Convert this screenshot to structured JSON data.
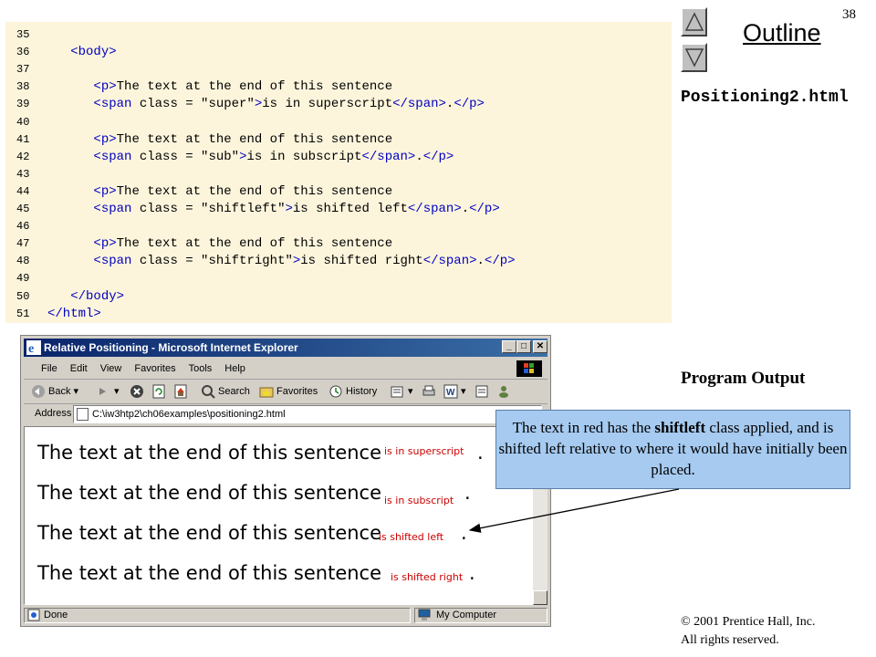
{
  "page_number": "38",
  "outline": {
    "title": "Outline",
    "up_button": "up-arrow",
    "down_button": "down-arrow",
    "file_name": "Positioning2.html"
  },
  "code_lines": [
    {
      "num": "35",
      "code": ""
    },
    {
      "num": "36",
      "code": "   <body>"
    },
    {
      "num": "37",
      "code": ""
    },
    {
      "num": "38",
      "code": "      <p>The text at the end of this sentence"
    },
    {
      "num": "39",
      "code": "      <span class = \"super\">is in superscript</span>.</p>"
    },
    {
      "num": "40",
      "code": ""
    },
    {
      "num": "41",
      "code": "      <p>The text at the end of this sentence"
    },
    {
      "num": "42",
      "code": "      <span class = \"sub\">is in subscript</span>.</p>"
    },
    {
      "num": "43",
      "code": ""
    },
    {
      "num": "44",
      "code": "      <p>The text at the end of this sentence"
    },
    {
      "num": "45",
      "code": "      <span class = \"shiftleft\">is shifted left</span>.</p>"
    },
    {
      "num": "46",
      "code": ""
    },
    {
      "num": "47",
      "code": "      <p>The text at the end of this sentence"
    },
    {
      "num": "48",
      "code": "      <span class = \"shiftright\">is shifted right</span>.</p>"
    },
    {
      "num": "49",
      "code": ""
    },
    {
      "num": "50",
      "code": "   </body>"
    },
    {
      "num": "51",
      "code": "</html>"
    }
  ],
  "program_output_label": "Program Output",
  "browser": {
    "title": "Relative Positioning - Microsoft Internet Explorer",
    "menu": [
      "File",
      "Edit",
      "View",
      "Favorites",
      "Tools",
      "Help"
    ],
    "toolbar": {
      "back": "Back",
      "search": "Search",
      "favorites": "Favorites",
      "history": "History"
    },
    "address_label": "Address",
    "address_value": "C:\\iw3htp2\\ch06examples\\positioning2.html",
    "status_left": "Done",
    "status_right": "My Computer",
    "sentences": [
      {
        "main": "The text at the end of this sentence",
        "span": "is in superscript",
        "end": "."
      },
      {
        "main": "The text at the end of this sentence",
        "span": "is in subscript",
        "end": "."
      },
      {
        "main": "The text at the end of this sentence",
        "span": "is shifted left",
        "end": "."
      },
      {
        "main": "The text at the end of this sentence",
        "span": "is shifted right",
        "end": "."
      }
    ]
  },
  "callout": {
    "part1": "The text in red has the ",
    "bold": "shiftleft",
    "part2": " class applied, and is shifted left relative to where it would have initially been placed."
  },
  "copyright": {
    "line1": "© 2001 Prentice Hall, Inc.",
    "line2": "All rights reserved."
  }
}
